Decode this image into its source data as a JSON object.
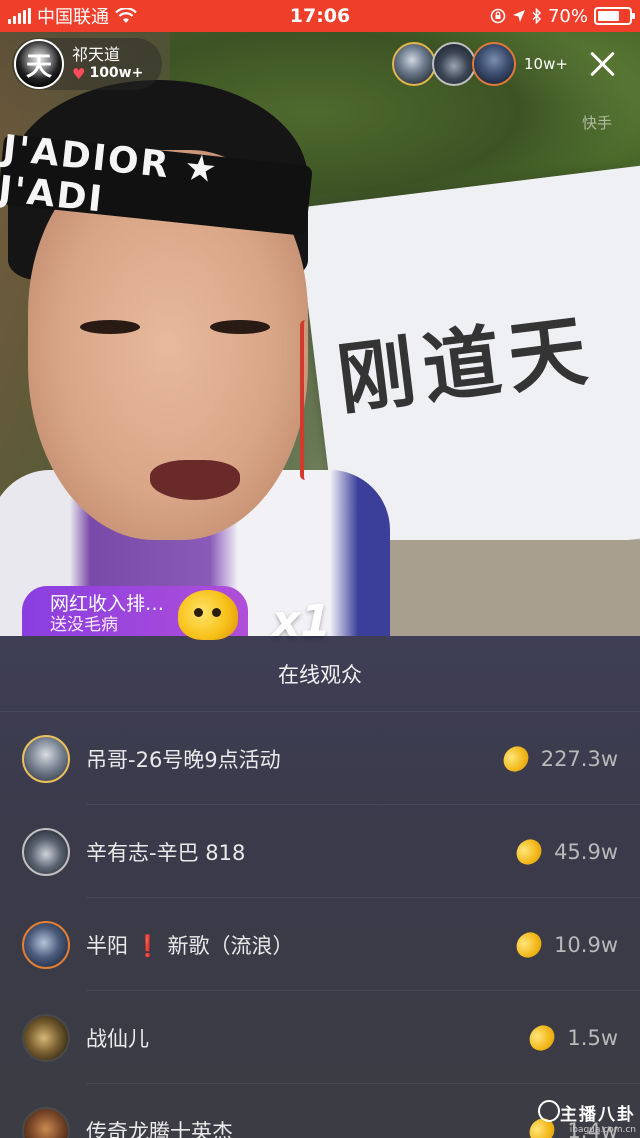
{
  "status_bar": {
    "carrier": "中国联通",
    "time": "17:06",
    "battery_percent": "70%",
    "battery_level": 0.7,
    "icons": [
      "signal-icon",
      "wifi-icon",
      "orientation-lock-icon",
      "location-icon",
      "bluetooth-icon",
      "battery-icon"
    ]
  },
  "host": {
    "avatar_text": "天",
    "name": "祁天道",
    "likes": "100w+",
    "likes_icon": "heart-icon"
  },
  "top_viewers": {
    "count_label": "10w+",
    "avatars": [
      "top-viewer-1",
      "top-viewer-2",
      "top-viewer-3"
    ]
  },
  "video": {
    "headband_text": "J'ADIOR ★ J'ADI",
    "banner_text": "刚道天",
    "watermark": "快手"
  },
  "rank_bubble": {
    "line1": "网红收入排…",
    "line2": "送没毛病",
    "combo": "x1"
  },
  "sheet": {
    "title": "在线观众",
    "rows": [
      {
        "name": "吊哥-26号晚9点活动",
        "score": "227.3w"
      },
      {
        "name": "辛有志-辛巴 818",
        "score": "45.9w"
      },
      {
        "name_prefix": "半阳",
        "name_mark": "❗",
        "name_suffix": "新歌（流浪）",
        "score": "10.9w"
      },
      {
        "name": "战仙儿",
        "score": "1.5w"
      },
      {
        "name": "传奇龙腾十英杰",
        "score": "1.4w"
      }
    ]
  },
  "watermark_bottom": {
    "main": "主播八卦",
    "sub": "ibagua.com.cn"
  },
  "colors": {
    "status_bar": "#ef3f2b",
    "sheet_bg": "#3c3c4a",
    "rank_pill": "#9a45de",
    "bean": "#f2b91c"
  }
}
